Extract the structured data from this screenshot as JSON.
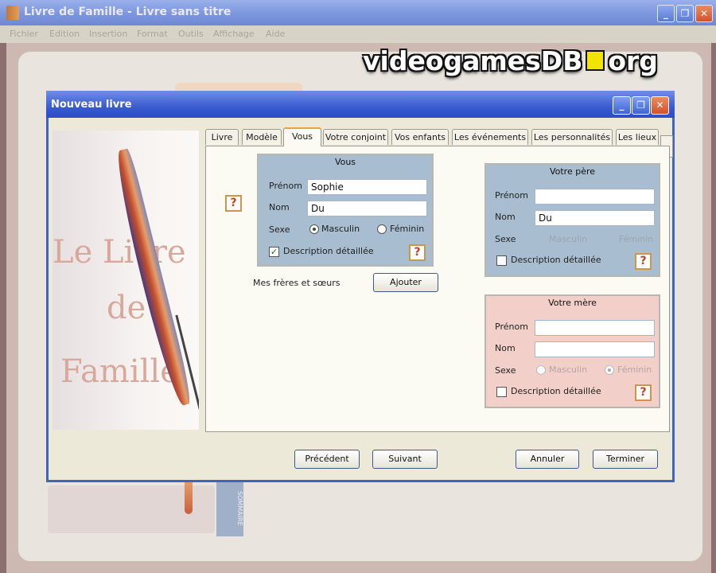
{
  "main": {
    "title": "Livre de Famille - Livre sans titre",
    "menu": [
      "Fichier",
      "Edition",
      "Insertion",
      "Format",
      "Outils",
      "Affichage",
      "Aide"
    ],
    "controls": {
      "minimize": "_",
      "restore": "❐",
      "close": "✕"
    },
    "ghost_spine": "SOMMAIRE"
  },
  "logo": {
    "left": "videogamesDB",
    "right": "org"
  },
  "dialog": {
    "title": "Nouveau livre",
    "side_image_words": [
      "Le Livre",
      "de",
      "Famille"
    ],
    "tabs": [
      "Livre",
      "Modèle",
      "Vous",
      "Votre conjoint",
      "Vos enfants",
      "Les événements",
      "Les personnalités",
      "Les lieux"
    ],
    "active_tab": "Vous",
    "vous": {
      "title": "Vous",
      "prenom_label": "Prénom",
      "prenom_value": "Sophie",
      "nom_label": "Nom",
      "nom_value": "Du",
      "sexe_label": "Sexe",
      "masculin": "Masculin",
      "feminin": "Féminin",
      "desc_label": "Description détaillée"
    },
    "siblings_label": "Mes frères et sœurs",
    "add_button": "Ajouter",
    "pere": {
      "title": "Votre père",
      "prenom_label": "Prénom",
      "prenom_value": "",
      "nom_label": "Nom",
      "nom_value": "Du",
      "sexe_label": "Sexe",
      "masculin": "Masculin",
      "feminin": "Féminin",
      "desc_label": "Description détaillée"
    },
    "mere": {
      "title": "Votre mère",
      "prenom_label": "Prénom",
      "prenom_value": "",
      "nom_label": "Nom",
      "nom_value": "",
      "sexe_label": "Sexe",
      "masculin": "Masculin",
      "feminin": "Féminin",
      "desc_label": "Description détaillée"
    },
    "help_glyph": "?",
    "buttons": {
      "previous": "Précédent",
      "next": "Suivant",
      "cancel": "Annuler",
      "finish": "Terminer"
    }
  },
  "colors": {
    "title_blue": "#3a5cd0",
    "vous_group": "#a9bdd0",
    "pere_group": "#a9bdd0",
    "mere_group": "#f2cfc8"
  }
}
